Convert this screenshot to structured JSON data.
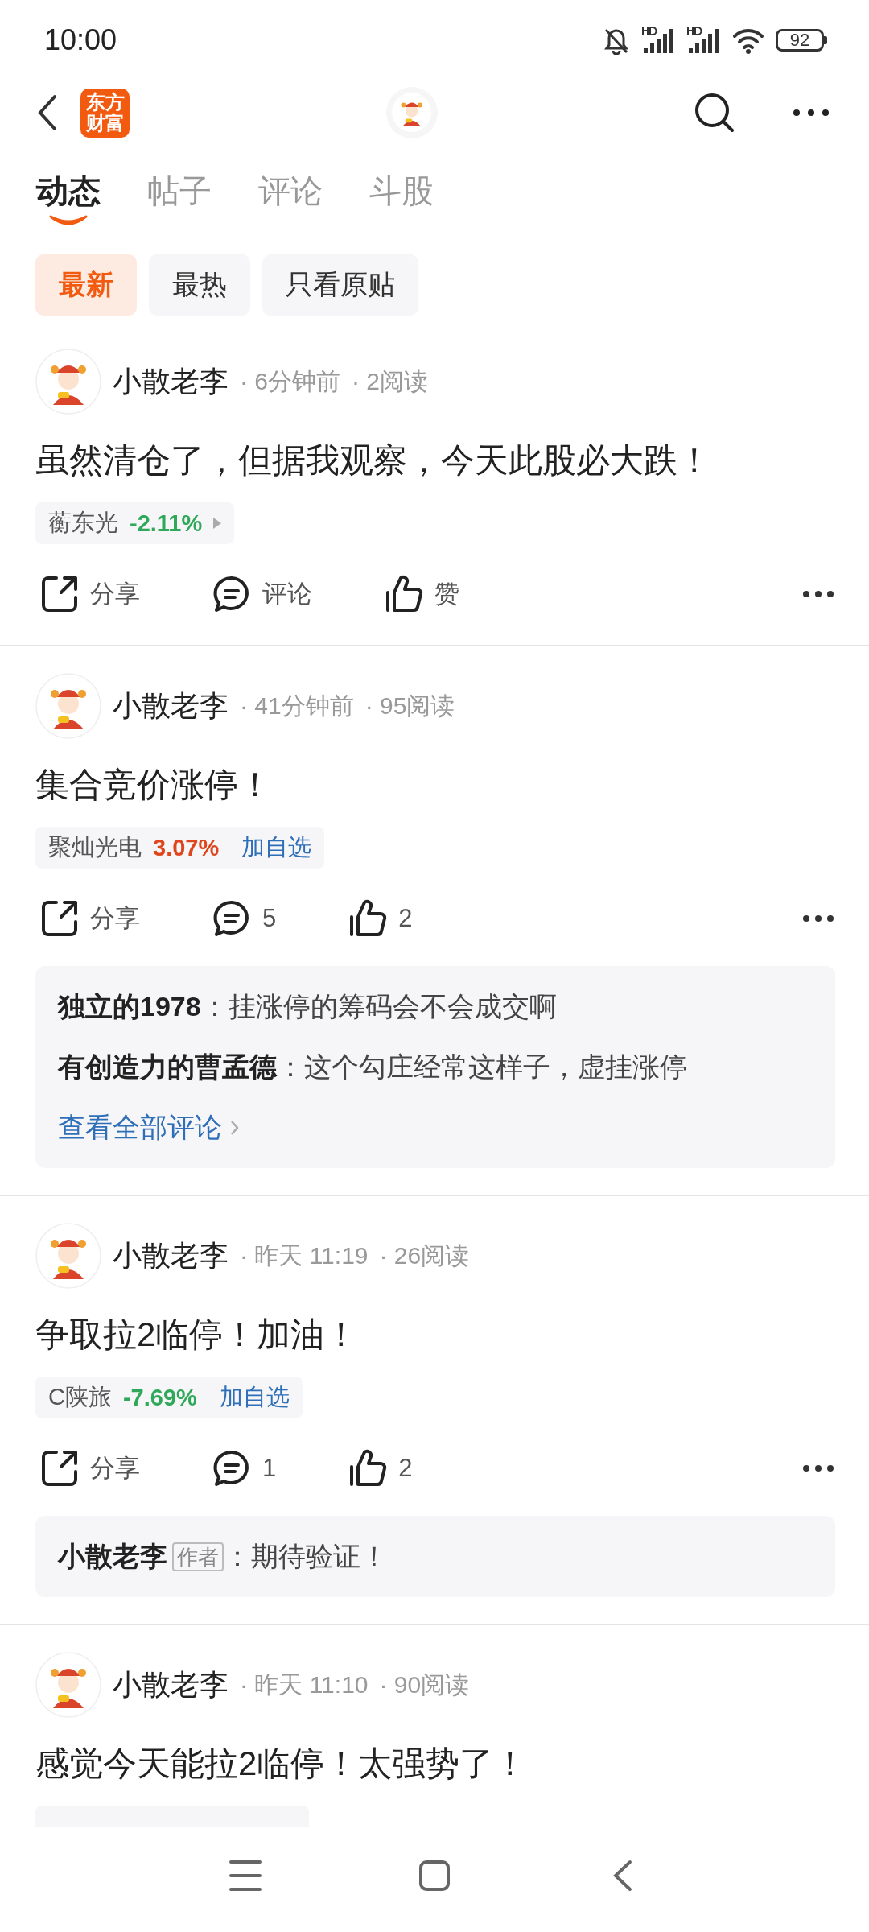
{
  "status_bar": {
    "time": "10:00",
    "battery": "92"
  },
  "header": {
    "logo": [
      "东方",
      "财富"
    ]
  },
  "tabs": [
    {
      "label": "动态",
      "selected": true
    },
    {
      "label": "帖子",
      "selected": false
    },
    {
      "label": "评论",
      "selected": false
    },
    {
      "label": "斗股",
      "selected": false
    }
  ],
  "filters": [
    {
      "label": "最新",
      "selected": true
    },
    {
      "label": "最热",
      "selected": false
    },
    {
      "label": "只看原贴",
      "selected": false
    }
  ],
  "posts": [
    {
      "author": "小散老李",
      "time": "· 6分钟前",
      "reads": "· 2阅读",
      "body": "虽然清仓了，但据我观察，今天此股必大跌！",
      "stock": {
        "kind": "expand",
        "name": "蘅东光",
        "change": "-2.11%",
        "color": "#2fa85a"
      },
      "share": "分享",
      "comment": "评论",
      "like": "赞"
    },
    {
      "author": "小散老李",
      "time": "· 41分钟前",
      "reads": "· 95阅读",
      "body": "集合竞价涨停！",
      "stock": {
        "kind": "watch",
        "name": "聚灿光电",
        "change": "3.07%",
        "color": "#e0461d",
        "action": "加自选"
      },
      "share": "分享",
      "comment": "5",
      "like": "2",
      "comments": [
        {
          "author": "独立的1978",
          "text": "：挂涨停的筹码会不会成交啊"
        },
        {
          "author": "有创造力的曹孟德",
          "text": "：这个勾庄经常这样子，虚挂涨停"
        }
      ],
      "view_all": "查看全部评论"
    },
    {
      "author": "小散老李",
      "time": "· 昨天 11:19",
      "reads": "· 26阅读",
      "body": "争取拉2临停！加油！",
      "stock": {
        "kind": "watch",
        "name": "C陕旅",
        "change": "-7.69%",
        "color": "#2fa85a",
        "action": "加自选"
      },
      "share": "分享",
      "comment": "1",
      "like": "2",
      "comments": [
        {
          "author": "小散老李",
          "badge": "作者",
          "text": "：期待验证！"
        }
      ]
    },
    {
      "author": "小散老李",
      "time": "· 昨天 11:10",
      "reads": "· 90阅读",
      "body": "感觉今天能拉2临停！太强势了！",
      "stock": {
        "kind": "cut"
      }
    }
  ]
}
